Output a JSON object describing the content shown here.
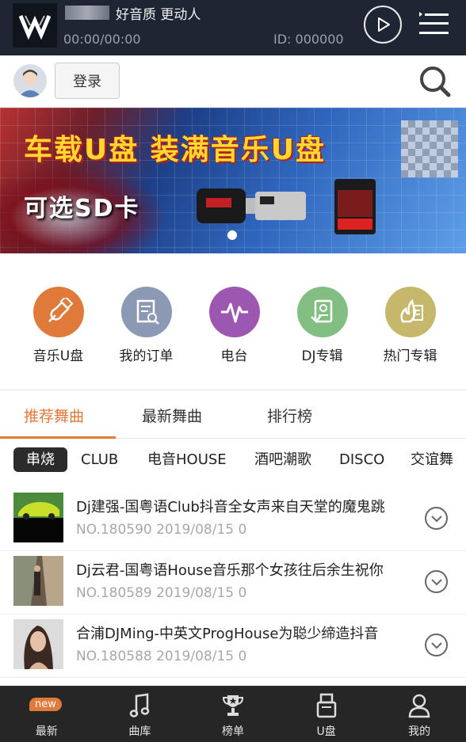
{
  "player": {
    "title": "好音质 更动人",
    "time": "00:00/00:00",
    "id_label": "ID: 000000"
  },
  "topbar": {
    "login_label": "登录"
  },
  "banner": {
    "headline": "车载U盘 装满音乐U盘",
    "subline": "可选SD卡"
  },
  "categories": [
    {
      "label": "音乐U盘",
      "color": "#e07a3a",
      "icon": "usb-plug-icon"
    },
    {
      "label": "我的订单",
      "color": "#8c99b5",
      "icon": "order-receipt-icon"
    },
    {
      "label": "电台",
      "color": "#9c58b0",
      "icon": "waveform-icon"
    },
    {
      "label": "DJ专辑",
      "color": "#82be82",
      "icon": "dj-album-icon"
    },
    {
      "label": "热门专辑",
      "color": "#c6b86a",
      "icon": "hot-album-icon"
    }
  ],
  "tabs": [
    {
      "label": "推荐舞曲",
      "active": true
    },
    {
      "label": "最新舞曲",
      "active": false
    },
    {
      "label": "排行榜",
      "active": false
    }
  ],
  "genres": [
    {
      "label": "串烧",
      "active": true
    },
    {
      "label": "CLUB",
      "active": false
    },
    {
      "label": "电音HOUSE",
      "active": false
    },
    {
      "label": "酒吧潮歌",
      "active": false
    },
    {
      "label": "DISCO",
      "active": false
    },
    {
      "label": "交谊舞",
      "active": false
    }
  ],
  "songs": [
    {
      "title": "Dj建强-国粤语Club抖音全女声来自天堂的魔鬼跳",
      "meta": "NO.180590 2019/08/15 0"
    },
    {
      "title": "Dj云君-国粤语House音乐那个女孩往后余生祝你",
      "meta": "NO.180589 2019/08/15 0"
    },
    {
      "title": "合浦DJMing-中英文ProgHouse为聪少缔造抖音",
      "meta": "NO.180588 2019/08/15 0"
    }
  ],
  "bottom_nav": [
    {
      "label": "最新",
      "icon": "new-icon",
      "badge": "new"
    },
    {
      "label": "曲库",
      "icon": "music-note-icon"
    },
    {
      "label": "榜单",
      "icon": "trophy-icon"
    },
    {
      "label": "U盘",
      "icon": "usb-drive-icon"
    },
    {
      "label": "我的",
      "icon": "user-icon"
    }
  ],
  "colors": {
    "accent": "#e07a3a",
    "player_bg": "#1f2633",
    "bottom_bg": "#262626"
  }
}
